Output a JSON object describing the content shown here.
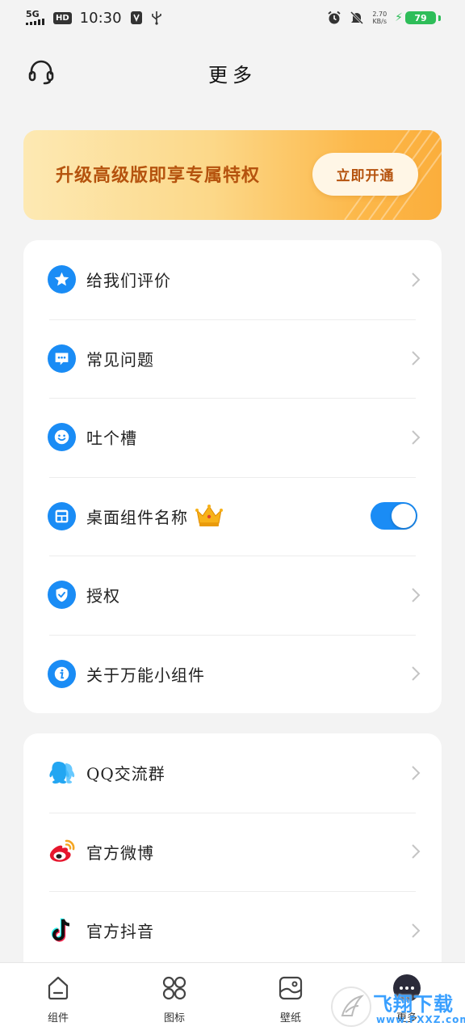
{
  "status_bar": {
    "network": "5G",
    "hd": "HD",
    "time": "10:30",
    "speed_value": "2.70",
    "speed_unit": "KB/s",
    "battery": "79"
  },
  "header": {
    "title": "更多"
  },
  "promo": {
    "text": "升级高级版即享专属特权",
    "button": "立即开通"
  },
  "card1": {
    "items": [
      {
        "label": "给我们评价",
        "icon": "star-icon"
      },
      {
        "label": "常见问题",
        "icon": "chat-bubble-icon"
      },
      {
        "label": "吐个槽",
        "icon": "smiley-icon"
      },
      {
        "label": "桌面组件名称",
        "icon": "widget-icon",
        "toggle_on": true,
        "badge": "crown-icon"
      },
      {
        "label": "授权",
        "icon": "shield-check-icon"
      },
      {
        "label": "关于万能小组件",
        "icon": "info-icon"
      }
    ]
  },
  "card2": {
    "items": [
      {
        "label": "QQ交流群",
        "icon": "qq-icon"
      },
      {
        "label": "官方微博",
        "icon": "weibo-icon"
      },
      {
        "label": "官方抖音",
        "icon": "douyin-icon"
      }
    ]
  },
  "bottom_nav": {
    "items": [
      {
        "label": "组件",
        "icon": "widget-tab-icon"
      },
      {
        "label": "图标",
        "icon": "icons-tab-icon"
      },
      {
        "label": "壁纸",
        "icon": "wallpaper-tab-icon"
      },
      {
        "label": "更多",
        "icon": "more-tab-icon"
      }
    ]
  },
  "watermark": {
    "title": "飞翔下载",
    "sub": "www.FXXZ.com"
  },
  "colors": {
    "accent": "#1a8cf5",
    "promo_text": "#b5530e",
    "battery": "#2ebd59"
  }
}
